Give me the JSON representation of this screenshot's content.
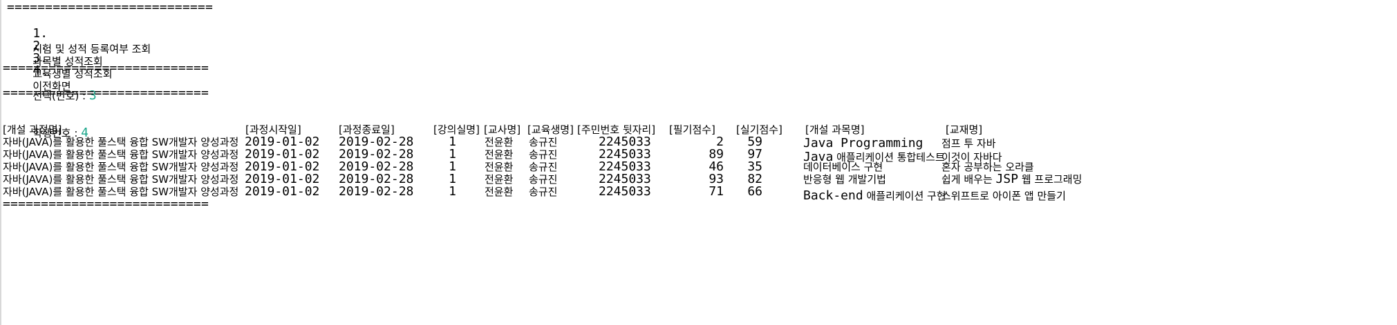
{
  "menu": {
    "separator_top": "===========================",
    "items": [
      {
        "number": "1.",
        "label": "시험 및 성적 등록여부 조회"
      },
      {
        "number": "2.",
        "label": "과목별 성적조회"
      },
      {
        "number": "3.",
        "label": "교육생별 성적조회"
      },
      {
        "number": "4.",
        "label": "이전화면"
      }
    ],
    "separator": "==========================="
  },
  "selection": {
    "prompt": "선택(번호) : ",
    "value": "3"
  },
  "student": {
    "prompt": "학생번호 : ",
    "value": "4"
  },
  "table": {
    "headers": [
      "[개설 과정명]",
      "[과정시작일]",
      "[과정종료일]",
      "[강의실명]",
      "[교사명]",
      "[교육생명]",
      "[주민번호 뒷자리]",
      "[필기점수]",
      "[실기점수]",
      "[개설 과목명]",
      "[교재명]"
    ],
    "rows": [
      {
        "course": "자바(JAVA)를 활용한 풀스택 융합 SW개발자 양성과정",
        "start": "2019-01-02",
        "end": "2019-02-28",
        "room": "1",
        "teacher": "전윤환",
        "student": "송규진",
        "ssn": "2245033",
        "written": "2",
        "practical": "59",
        "subject": "Java Programming",
        "book": "점프 투 자바"
      },
      {
        "course": "자바(JAVA)를 활용한 풀스택 융합 SW개발자 양성과정",
        "start": "2019-01-02",
        "end": "2019-02-28",
        "room": "1",
        "teacher": "전윤환",
        "student": "송규진",
        "ssn": "2245033",
        "written": "89",
        "practical": "97",
        "subject": "Java 애플리케이션 통합테스트",
        "book": "이것이 자바다"
      },
      {
        "course": "자바(JAVA)를 활용한 풀스택 융합 SW개발자 양성과정",
        "start": "2019-01-02",
        "end": "2019-02-28",
        "room": "1",
        "teacher": "전윤환",
        "student": "송규진",
        "ssn": "2245033",
        "written": "46",
        "practical": "35",
        "subject": "데이터베이스 구현",
        "book": "혼자 공부하는 오라클"
      },
      {
        "course": "자바(JAVA)를 활용한 풀스택 융합 SW개발자 양성과정",
        "start": "2019-01-02",
        "end": "2019-02-28",
        "room": "1",
        "teacher": "전윤환",
        "student": "송규진",
        "ssn": "2245033",
        "written": "93",
        "practical": "82",
        "subject": "반응형 웹 개발기법",
        "book": "쉽게 배우는 JSP 웹 프로그래밍"
      },
      {
        "course": "자바(JAVA)를 활용한 풀스택 융합 SW개발자 양성과정",
        "start": "2019-01-02",
        "end": "2019-02-28",
        "room": "1",
        "teacher": "전윤환",
        "student": "송규진",
        "ssn": "2245033",
        "written": "71",
        "practical": "66",
        "subject": "Back-end 애플리케이션 구현",
        "book": "스위프트로 아이폰 앱 만들기"
      }
    ],
    "separator_bottom": "==========================="
  },
  "colors": {
    "input_value": "#17a589",
    "text": "#000000",
    "background": "#ffffff"
  }
}
